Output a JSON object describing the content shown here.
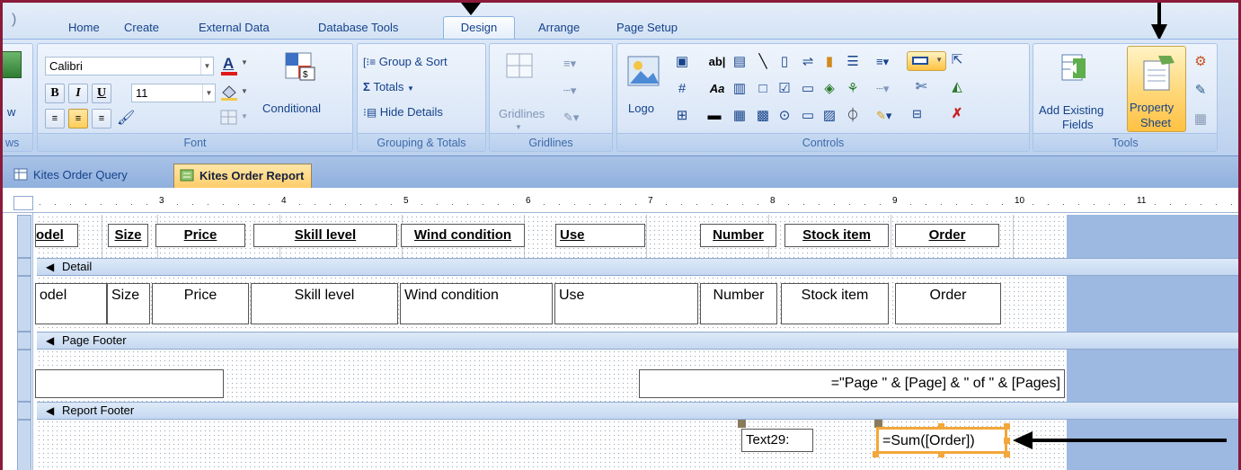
{
  "ribbon_tabs": [
    "Home",
    "Create",
    "External Data",
    "Database Tools",
    "Design",
    "Arrange",
    "Page Setup"
  ],
  "active_tab": "Design",
  "groups": {
    "views_fragment": "ws",
    "font": {
      "title": "Font",
      "font_name": "Calibri",
      "font_size": "11",
      "bold": "B",
      "italic": "I",
      "underline": "U",
      "conditional": "Conditional"
    },
    "grouping": {
      "title": "Grouping & Totals",
      "group_sort": "Group & Sort",
      "totals": "Totals",
      "hide_details": "Hide Details"
    },
    "gridlines": {
      "title": "Gridlines",
      "label": "Gridlines"
    },
    "controls": {
      "title": "Controls",
      "logo": "Logo",
      "ab": "ab|",
      "aa": "Aa"
    },
    "tools": {
      "title": "Tools",
      "add_existing_1": "Add Existing",
      "add_existing_2": "Fields",
      "property_1": "Property",
      "property_2": "Sheet"
    }
  },
  "doc_tabs": [
    "Kites Order Query",
    "Kites Order Report"
  ],
  "active_doc_tab": "Kites Order Report",
  "ruler_numbers": [
    "3",
    "4",
    "5",
    "6",
    "7",
    "8",
    "9",
    "10",
    "11"
  ],
  "header_labels": [
    "odel",
    "Size",
    "Price",
    "Skill level",
    "Wind condition",
    "Use",
    "Number",
    "Stock item",
    "Order"
  ],
  "sections": {
    "detail": "Detail",
    "page_footer": "Page Footer",
    "report_footer": "Report Footer"
  },
  "detail_fields": [
    "odel",
    "Size",
    "Price",
    "Skill level",
    "Wind condition",
    "Use",
    "Number",
    "Stock item",
    "Order"
  ],
  "page_footer_expr": "=\"Page \" & [Page] & \" of \" & [Pages]",
  "report_footer": {
    "label": "Text29:",
    "expr": "=Sum([Order])"
  },
  "colors": {
    "frame": "#8b1a3a",
    "selection": "#f3a73a",
    "active_tool": "#ffd777"
  }
}
